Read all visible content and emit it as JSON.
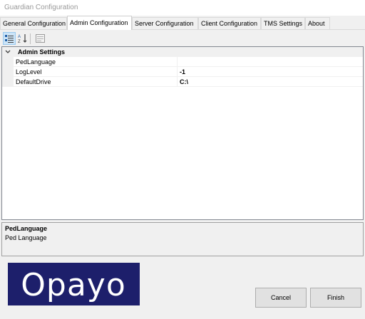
{
  "window": {
    "title": "Guardian Configuration"
  },
  "tabs": [
    {
      "label": "General Configuration"
    },
    {
      "label": "Admin Configuration"
    },
    {
      "label": "Server Configuration"
    },
    {
      "label": "Client Configuration"
    },
    {
      "label": "TMS Settings"
    },
    {
      "label": "About"
    }
  ],
  "active_tab": "Admin Configuration",
  "toolbar": {
    "buttons": [
      {
        "icon": "categorized-icon",
        "pressed": true
      },
      {
        "icon": "alphabetical-sort-icon",
        "pressed": false
      },
      {
        "icon": "property-pages-icon",
        "pressed": false
      }
    ]
  },
  "property_grid": {
    "category": {
      "label": "Admin Settings",
      "expanded": true
    },
    "rows": [
      {
        "name": "PedLanguage",
        "value": ""
      },
      {
        "name": "LogLevel",
        "value": "-1"
      },
      {
        "name": "DefaultDrive",
        "value": "C:\\"
      }
    ],
    "selected_row": "PedLanguage"
  },
  "description": {
    "title": "PedLanguage",
    "text": "Ped Language"
  },
  "logo": {
    "text": "Opayo",
    "background": "#1d1f6b",
    "color": "#ffffff"
  },
  "buttons": {
    "cancel": "Cancel",
    "finish": "Finish"
  }
}
